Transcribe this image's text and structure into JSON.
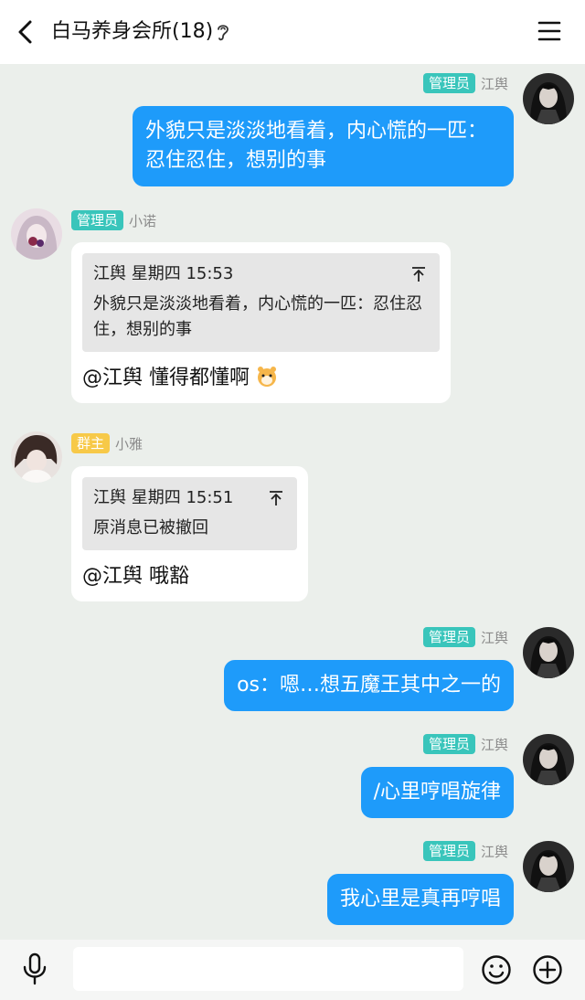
{
  "header": {
    "title": "白马养身会所(18)"
  },
  "messages": [
    {
      "direction": "out",
      "badge": "管理员",
      "sender": "江舆",
      "text": "外貌只是淡淡地看着，内心慌的一匹：忍住忍住，想别的事"
    },
    {
      "direction": "in",
      "badge": "管理员",
      "sender": "小诺",
      "quote": {
        "header": "江舆 星期四 15:53",
        "body": "外貌只是淡淡地看着，内心慌的一匹：忍住忍住，想别的事"
      },
      "reply": "@江舆 懂得都懂啊"
    },
    {
      "direction": "in",
      "badge": "群主",
      "sender": "小雅",
      "quote": {
        "header": "江舆 星期四 15:51",
        "body": "原消息已被撤回"
      },
      "reply": "@江舆 哦豁"
    },
    {
      "direction": "out",
      "badge": "管理员",
      "sender": "江舆",
      "text": "os：嗯…想五魔王其中之一的"
    },
    {
      "direction": "out",
      "badge": "管理员",
      "sender": "江舆",
      "text": "/心里哼唱旋律"
    },
    {
      "direction": "out",
      "badge": "管理员",
      "sender": "江舆",
      "text": "我心里是真再哼唱"
    }
  ],
  "input": {
    "value": ""
  },
  "colors": {
    "background": "#ebefeb",
    "outgoing_bubble": "#1e9bfa",
    "admin_badge": "#39c5bb",
    "owner_badge": "#f7c948"
  },
  "icons": {
    "back": "back-arrow-icon",
    "ear": "ear-icon",
    "menu": "menu-icon",
    "mic": "microphone-icon",
    "emoji": "emoji-icon",
    "plus": "plus-icon",
    "pin": "jump-to-original-icon"
  }
}
